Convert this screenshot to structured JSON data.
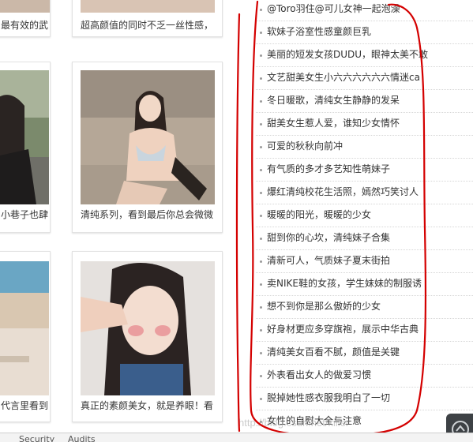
{
  "gallery": {
    "cards": [
      {
        "caption": "最有效的武"
      },
      {
        "caption": "超高颜值的同时不乏一丝性感，"
      },
      {
        "caption": "小巷子也肆"
      },
      {
        "caption": "清纯系列，看到最后你总会微微"
      },
      {
        "caption": "代言里看到"
      },
      {
        "caption": "真正的素颜美女，就是养眼！看"
      }
    ]
  },
  "article_list": {
    "items": [
      "@Toro羽住@可儿女神一起泡澡",
      "软妹子浴室性感童颜巨乳",
      "美丽的短发女孩DUDU，眼神太美不敢",
      "文艺甜美女生小六六六六六六情迷ca",
      "冬日暖歌，清纯女生静静的发呆",
      "甜美女生惹人爱，谁知少女情怀",
      "可爱的秋秋向前冲",
      "有气质的多才多艺知性萌妹子",
      "爆红清纯校花生活照，嫣然巧笑讨人",
      "暖暖的阳光，暖暖的少女",
      "甜到你的心坎，清纯妹子合集",
      "清新可人，气质妹子夏末街拍",
      "卖NIKE鞋的女孩，学生妹妹的制服诱",
      "想不到你是那么傲娇的少女",
      "好身材更应多穿旗袍，展示中华古典",
      "清纯美女百看不腻，颜值是关键",
      "外表看出女人的做爱习惯",
      "脱掉她性感衣服我明白了一切",
      "女性的自慰大全与注意"
    ]
  },
  "devtools": {
    "tabs": [
      "Security",
      "Audits"
    ]
  },
  "watermark": "http://blog.csdn.net/killer",
  "colors": {
    "annotation": "#d40000",
    "text": "#333333",
    "divider": "#d6d6d6"
  }
}
